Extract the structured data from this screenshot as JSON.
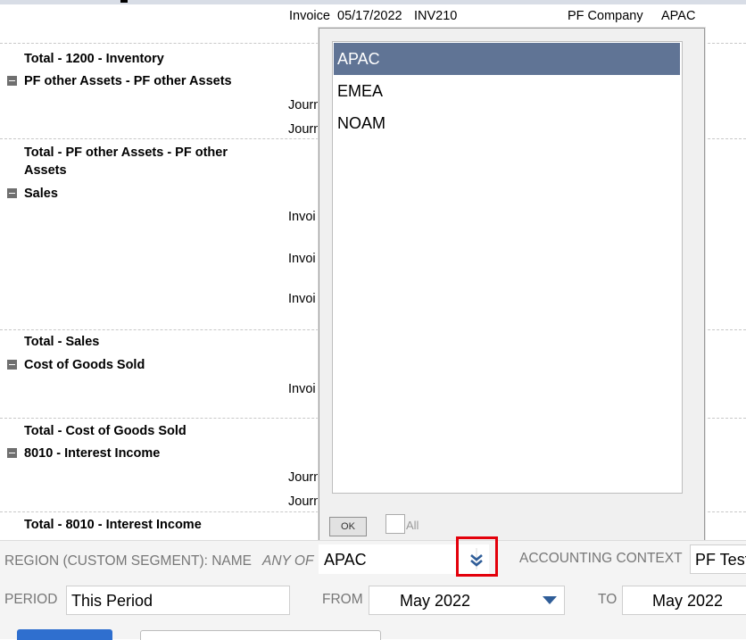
{
  "report": {
    "header_row": {
      "type": "Invoice",
      "date": "05/17/2022",
      "number": "INV210",
      "entity": "PF Company",
      "region": "APAC"
    },
    "inventory_total": "Total - 1200 - Inventory",
    "pf_other_assets": "PF other Assets - PF other Assets",
    "journ_1": "Journ",
    "journ_2": "Journ",
    "pf_other_total_line1": "Total - PF other Assets - PF other",
    "pf_other_total_line2": "Assets",
    "sales": "Sales",
    "invoi_1": "Invoi",
    "invoi_2": "Invoi",
    "invoi_3": "Invoi",
    "sales_total": "Total - Sales",
    "cogs": "Cost of Goods Sold",
    "invoi_4": "Invoi",
    "cogs_total": "Total - Cost of Goods Sold",
    "interest": "8010 - Interest Income",
    "journ_3": "Journ",
    "journ_4": "Journ",
    "interest_total": "Total - 8010 - Interest Income"
  },
  "dropdown": {
    "options": [
      "APAC",
      "EMEA",
      "NOAM"
    ],
    "selected": "APAC",
    "ok_label": "OK",
    "all_label": "All"
  },
  "filters": {
    "region_label": "REGION (CUSTOM SEGMENT): NAME",
    "region_qualifier": "ANY OF",
    "region_value": "APAC",
    "accounting_context_label": "ACCOUNTING CONTEXT",
    "accounting_context_value": "PF Test",
    "period_label": "PERIOD",
    "period_value": "This Period",
    "from_label": "FROM",
    "from_value": "May 2022",
    "to_label": "TO",
    "to_value": "May 2022"
  },
  "colors": {
    "selected_option_bg": "#607495",
    "highlight_box": "#e3000b",
    "dropdown_icon": "#2f5d98"
  }
}
